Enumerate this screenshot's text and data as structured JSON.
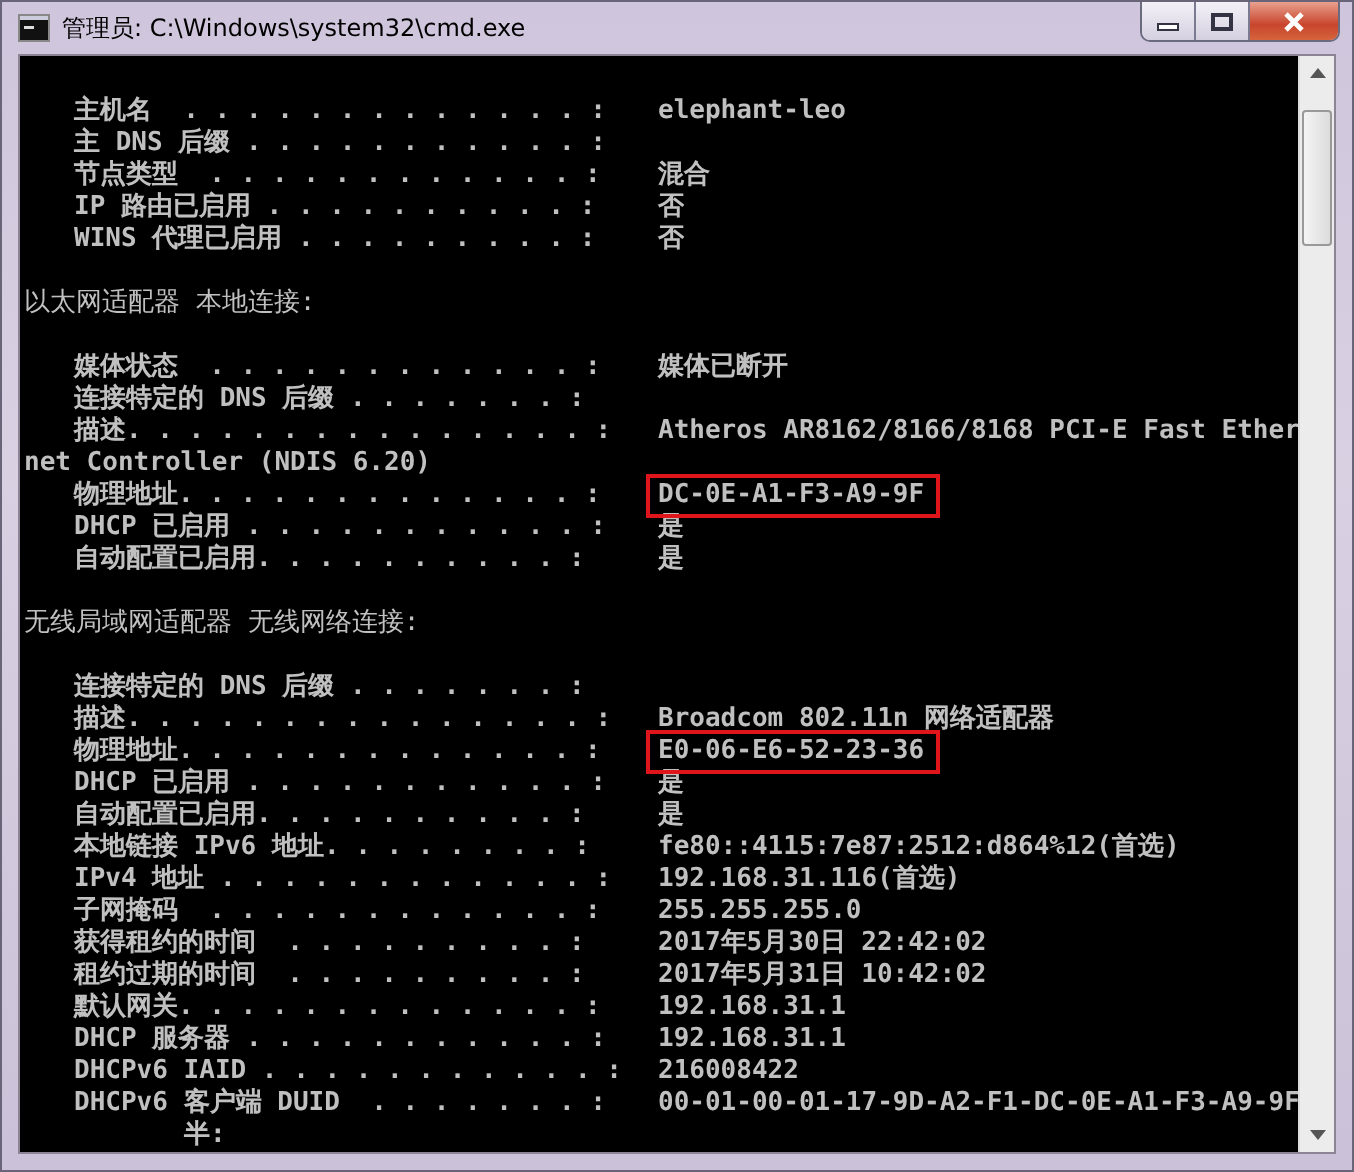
{
  "window": {
    "title": "管理员: C:\\Windows\\system32\\cmd.exe"
  },
  "console": {
    "lines": [
      {
        "kind": "blank"
      },
      {
        "kind": "entry",
        "label": "主机名  . . . . . . . . . . . . . :",
        "value": "elephant-leo"
      },
      {
        "kind": "entry",
        "label": "主 DNS 后缀 . . . . . . . . . . . :"
      },
      {
        "kind": "entry",
        "label": "节点类型  . . . . . . . . . . . . :",
        "value": "混合"
      },
      {
        "kind": "entry",
        "label": "IP 路由已启用 . . . . . . . . . . :",
        "value": "否"
      },
      {
        "kind": "entry",
        "label": "WINS 代理已启用 . . . . . . . . . :",
        "value": "否"
      },
      {
        "kind": "blank"
      },
      {
        "kind": "heading",
        "text": "以太网适配器 本地连接:"
      },
      {
        "kind": "blank"
      },
      {
        "kind": "entry",
        "label": "媒体状态  . . . . . . . . . . . . :",
        "value": "媒体已断开"
      },
      {
        "kind": "entry",
        "label": "连接特定的 DNS 后缀 . . . . . . . :"
      },
      {
        "kind": "entry",
        "label": "描述. . . . . . . . . . . . . . . :",
        "value": "Atheros AR8162/8166/8168 PCI-E Fast Ether"
      },
      {
        "kind": "continuation",
        "text": "net Controller (NDIS 6.20)"
      },
      {
        "kind": "entry",
        "label": "物理地址. . . . . . . . . . . . . :",
        "value": "DC-0E-A1-F3-A9-9F",
        "highlighted": true
      },
      {
        "kind": "entry",
        "label": "DHCP 已启用 . . . . . . . . . . . :",
        "value": "是"
      },
      {
        "kind": "entry",
        "label": "自动配置已启用. . . . . . . . . . :",
        "value": "是"
      },
      {
        "kind": "blank"
      },
      {
        "kind": "heading",
        "text": "无线局域网适配器 无线网络连接:"
      },
      {
        "kind": "blank"
      },
      {
        "kind": "entry",
        "label": "连接特定的 DNS 后缀 . . . . . . . :"
      },
      {
        "kind": "entry",
        "label": "描述. . . . . . . . . . . . . . . :",
        "value": "Broadcom 802.11n 网络适配器"
      },
      {
        "kind": "entry",
        "label": "物理地址. . . . . . . . . . . . . :",
        "value": "E0-06-E6-52-23-36",
        "highlighted": true
      },
      {
        "kind": "entry",
        "label": "DHCP 已启用 . . . . . . . . . . . :",
        "value": "是"
      },
      {
        "kind": "entry",
        "label": "自动配置已启用. . . . . . . . . . :",
        "value": "是"
      },
      {
        "kind": "entry",
        "label": "本地链接 IPv6 地址. . . . . . . . :",
        "value": "fe80::4115:7e87:2512:d864%12(首选)"
      },
      {
        "kind": "entry",
        "label": "IPv4 地址 . . . . . . . . . . . . :",
        "value": "192.168.31.116(首选)"
      },
      {
        "kind": "entry",
        "label": "子网掩码  . . . . . . . . . . . . :",
        "value": "255.255.255.0"
      },
      {
        "kind": "entry",
        "label": "获得租约的时间  . . . . . . . . . :",
        "value": "2017年5月30日 22:42:02"
      },
      {
        "kind": "entry",
        "label": "租约过期的时间  . . . . . . . . . :",
        "value": "2017年5月31日 10:42:02"
      },
      {
        "kind": "entry",
        "label": "默认网关. . . . . . . . . . . . . :",
        "value": "192.168.31.1"
      },
      {
        "kind": "entry",
        "label": "DHCP 服务器 . . . . . . . . . . . :",
        "value": "192.168.31.1"
      },
      {
        "kind": "entry",
        "label": "DHCPv6 IAID . . . . . . . . . . . :",
        "value": "216008422"
      },
      {
        "kind": "entry",
        "label": "DHCPv6 客户端 DUID  . . . . . . . :",
        "value": "00-01-00-01-17-9D-A2-F1-DC-0E-A1-F3-A9-9F"
      },
      {
        "kind": "fragment",
        "text": "半:"
      }
    ]
  }
}
